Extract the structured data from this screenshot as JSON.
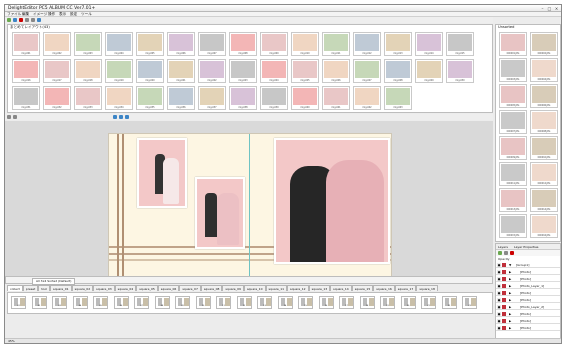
{
  "window": {
    "title": "DelightEditor PC5 ALBUM CC Ver7.01+",
    "controls": [
      "minimize",
      "maximize",
      "close"
    ]
  },
  "menu": [
    {
      "label": "ファイル"
    },
    {
      "label": "編集"
    },
    {
      "label": "イメージ"
    },
    {
      "label": "操作"
    },
    {
      "label": "表示"
    },
    {
      "label": "設定"
    },
    {
      "label": "ツール"
    }
  ],
  "library": {
    "title": "まとめてレイアウト(43)",
    "rows": 3,
    "thumb_captions": [
      "img-001",
      "img-002",
      "img-003",
      "img-004",
      "img-005",
      "img-006",
      "img-007",
      "img-008",
      "img-009",
      "img-010",
      "img-011",
      "img-012",
      "img-013",
      "img-014",
      "img-015",
      "img-016",
      "img-017",
      "img-018",
      "img-019",
      "img-020",
      "img-021",
      "img-022",
      "img-023",
      "img-024",
      "img-025",
      "img-026",
      "img-027",
      "img-028",
      "img-029",
      "img-030",
      "img-031",
      "img-032",
      "img-033",
      "img-034",
      "img-035",
      "img-036",
      "img-037",
      "img-038",
      "img-039",
      "img-040",
      "img-041",
      "img-042",
      "img-043"
    ]
  },
  "right_panel": {
    "title": "Unsorted",
    "items": [
      "000001.JPG",
      "000002.JPG",
      "000003.JPG",
      "000004.JPG",
      "000005.JPG",
      "000006.JPG",
      "000007.JPG",
      "000008.JPG",
      "000009.JPG",
      "000010.JPG",
      "000011.JPG",
      "000012.JPG",
      "000013.JPG",
      "000014.JPG",
      "000015.JPG",
      "000016.JPG"
    ]
  },
  "spread": {
    "background": "#fdf6e3",
    "stripe_color": "#b08f72",
    "photo_bg": "#f3c8c8"
  },
  "page_tabs": {
    "active": "All 3x4 Sorted (Default)",
    "tabs": [
      "collect",
      "preset",
      "tool",
      "square_01",
      "square_02",
      "square_03",
      "square_04",
      "square_05",
      "square_06",
      "square_07",
      "square_08",
      "square_09",
      "square_10",
      "square_11",
      "square_12",
      "square_13",
      "square_14",
      "square_15",
      "square_16",
      "square_17",
      "square_18"
    ]
  },
  "strip": {
    "count": 23,
    "captions": [
      "01",
      "02",
      "03",
      "04",
      "05",
      "06",
      "07",
      "08",
      "09",
      "10",
      "11",
      "12",
      "13",
      "14",
      "15",
      "16",
      "17",
      "18",
      "19",
      "20",
      "21",
      "22",
      "23"
    ]
  },
  "layers": {
    "tabs": [
      "Layers",
      "Layer Properties"
    ],
    "header": "Opacity",
    "rows": [
      {
        "name": "[Group1]",
        "indent": 0
      },
      {
        "name": "[Photo]",
        "indent": 1
      },
      {
        "name": "[Photo]",
        "indent": 1
      },
      {
        "name": "[Photo_Layer_1]",
        "indent": 1
      },
      {
        "name": "[Photo]",
        "indent": 1
      },
      {
        "name": "[Photo]",
        "indent": 1
      },
      {
        "name": "[Photo_Layer_2]",
        "indent": 1
      },
      {
        "name": "[Photo]",
        "indent": 1
      },
      {
        "name": "[Photo]",
        "indent": 1
      },
      {
        "name": "[Photo]",
        "indent": 1
      }
    ]
  },
  "status": {
    "zoom": "45%"
  }
}
